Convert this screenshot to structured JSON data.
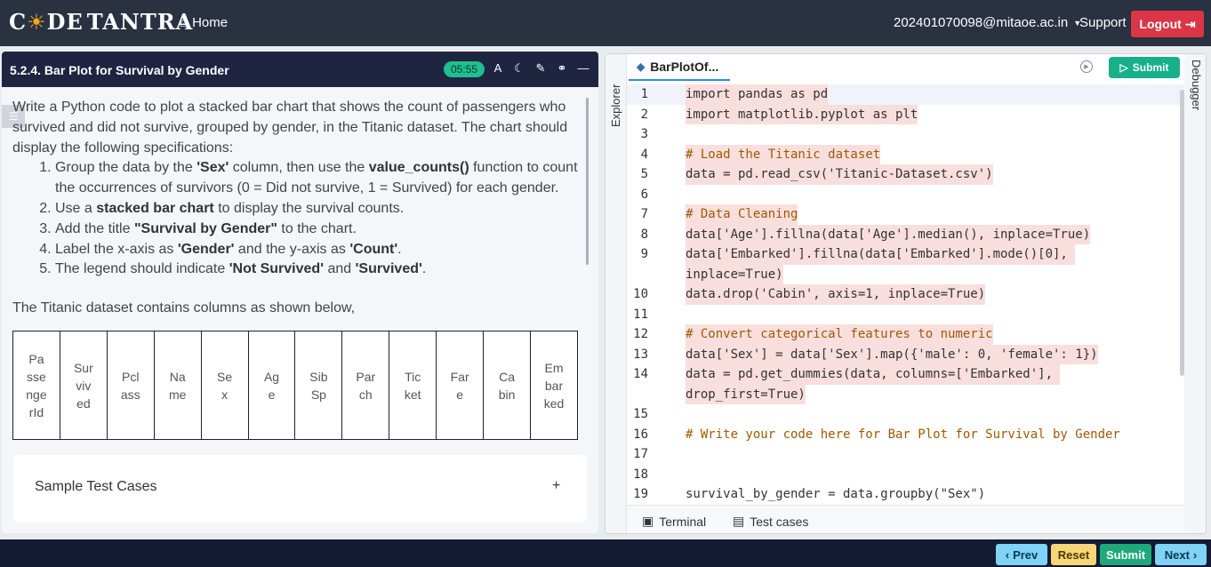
{
  "header": {
    "logo": "CODETANTRA",
    "home_label": "Home",
    "user_email": "202401070098@mitaoe.ac.in",
    "support_label": "Support",
    "logout_label": "Logout"
  },
  "problem": {
    "title": "5.2.4. Bar Plot for Survival by Gender",
    "timer": "05:55",
    "intro": "Write a Python code to plot a stacked bar chart that shows the count of passengers who survived and did not survive, grouped by gender, in the Titanic dataset. The chart should display the following specifications:",
    "items": [
      {
        "pre": "Group the data by the ",
        "b1": "'Sex'",
        "mid": " column, then use the ",
        "b2": "value_counts()",
        "post": " function to count the occurrences of survivors (0 = Did not survive, 1 = Survived) for each gender."
      },
      {
        "pre": "Use a ",
        "b1": "stacked bar chart",
        "mid": " to display the survival counts.",
        "b2": "",
        "post": ""
      },
      {
        "pre": "Add the title ",
        "b1": "\"Survival by Gender\"",
        "mid": " to the chart.",
        "b2": "",
        "post": ""
      },
      {
        "pre": "Label the x-axis as ",
        "b1": "'Gender'",
        "mid": " and the y-axis as ",
        "b2": "'Count'",
        "post": "."
      },
      {
        "pre": "The legend should indicate ",
        "b1": "'Not Survived'",
        "mid": " and ",
        "b2": "'Survived'",
        "post": "."
      }
    ],
    "dataset_note": "The Titanic dataset contains columns as shown below,",
    "columns": [
      "PassengerId",
      "Survived",
      "Pclass",
      "Name",
      "Sex",
      "Age",
      "SibSp",
      "Parch",
      "Ticket",
      "Fare",
      "Cabin",
      "Embarked"
    ],
    "sample_label": "Sample Test Cases",
    "sample_toggle": "+"
  },
  "editor": {
    "explorer_label": "Explorer",
    "debugger_label": "Debugger",
    "file_tab": "BarPlotOf...",
    "submit_label": "Submit",
    "terminal_label": "Terminal",
    "testcases_label": "Test cases",
    "lines": [
      {
        "n": "1",
        "text": "import pandas as pd"
      },
      {
        "n": "2",
        "text": "import matplotlib.pyplot as plt"
      },
      {
        "n": "3",
        "text": ""
      },
      {
        "n": "4",
        "text": "# Load the Titanic dataset"
      },
      {
        "n": "5",
        "text": "data = pd.read_csv('Titanic-Dataset.csv')"
      },
      {
        "n": "6",
        "text": ""
      },
      {
        "n": "7",
        "text": "# Data Cleaning"
      },
      {
        "n": "8",
        "text": "data['Age'].fillna(data['Age'].median(), inplace=True)"
      },
      {
        "n": "9",
        "text": "data['Embarked'].fillna(data['Embarked'].mode()[0], "
      },
      {
        "n": "",
        "text": "inplace=True)"
      },
      {
        "n": "10",
        "text": "data.drop('Cabin', axis=1, inplace=True)"
      },
      {
        "n": "11",
        "text": ""
      },
      {
        "n": "12",
        "text": "# Convert categorical features to numeric"
      },
      {
        "n": "13",
        "text": "data['Sex'] = data['Sex'].map({'male': 0, 'female': 1})"
      },
      {
        "n": "14",
        "text": "data = pd.get_dummies(data, columns=['Embarked'], "
      },
      {
        "n": "",
        "text": "drop_first=True)"
      },
      {
        "n": "15",
        "text": ""
      },
      {
        "n": "16",
        "text": "# Write your code here for Bar Plot for Survival by Gender"
      },
      {
        "n": "17",
        "text": ""
      },
      {
        "n": "18",
        "text": ""
      },
      {
        "n": "19",
        "text": "survival_by_gender = data.groupby(\"Sex\")"
      }
    ]
  },
  "footer": {
    "prev_label": "Prev",
    "reset_label": "Reset",
    "submit_label": "Submit",
    "next_label": "Next"
  },
  "colors": {
    "header_bg": "#2a3140",
    "logout": "#dc3545",
    "timer": "#1fbf8f",
    "submit": "#16b08b",
    "footer_bg": "#151a33",
    "code_highlight": "#f9dede"
  }
}
